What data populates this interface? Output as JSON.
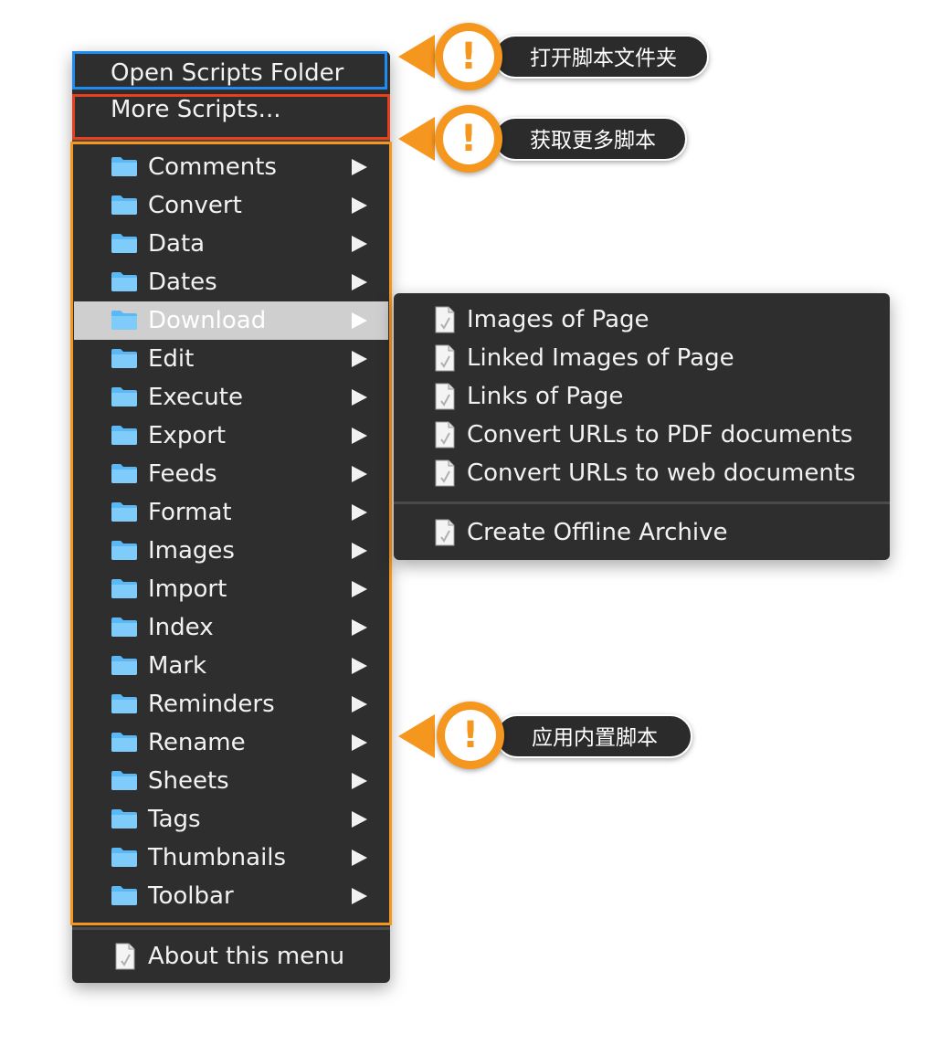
{
  "menu": {
    "open_scripts_folder": "Open Scripts Folder",
    "more_scripts": "More Scripts...",
    "folders": [
      {
        "label": "Comments"
      },
      {
        "label": "Convert"
      },
      {
        "label": "Data"
      },
      {
        "label": "Dates"
      },
      {
        "label": "Download",
        "selected": true
      },
      {
        "label": "Edit"
      },
      {
        "label": "Execute"
      },
      {
        "label": "Export"
      },
      {
        "label": "Feeds"
      },
      {
        "label": "Format"
      },
      {
        "label": "Images"
      },
      {
        "label": "Import"
      },
      {
        "label": "Index"
      },
      {
        "label": "Mark"
      },
      {
        "label": "Reminders"
      },
      {
        "label": "Rename"
      },
      {
        "label": "Sheets"
      },
      {
        "label": "Tags"
      },
      {
        "label": "Thumbnails"
      },
      {
        "label": "Toolbar"
      }
    ],
    "about": "About this menu"
  },
  "submenu": {
    "items": [
      {
        "label": "Images of Page"
      },
      {
        "label": "Linked Images of Page"
      },
      {
        "label": "Links of Page"
      },
      {
        "label": "Convert URLs to PDF documents"
      },
      {
        "label": "Convert URLs to web documents"
      }
    ],
    "after_divider": {
      "label": "Create Offline Archive"
    }
  },
  "callouts": {
    "open_folder": {
      "text": "打开脚本文件夹",
      "icon": "exclamation-icon"
    },
    "more_scripts": {
      "text": "获取更多脚本",
      "icon": "exclamation-icon"
    },
    "builtin_scripts": {
      "text": "应用内置脚本",
      "icon": "exclamation-icon"
    }
  },
  "colors": {
    "menu_bg": "#2e2e2e",
    "highlight_blue": "#1e8cf0",
    "highlight_red": "#e8401c",
    "highlight_orange": "#f5961e",
    "folder_blue": "#5bb8f5",
    "selected_bg": "#cfcfcf"
  },
  "exclamation": "!"
}
